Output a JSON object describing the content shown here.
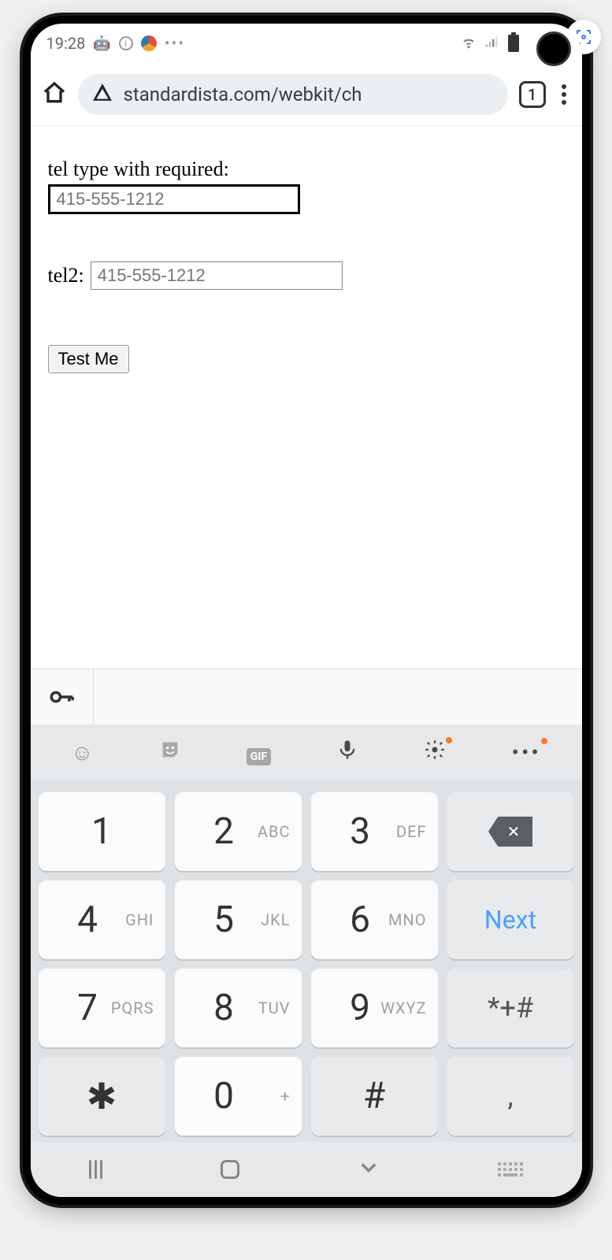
{
  "status": {
    "time": "19:28"
  },
  "browser": {
    "url": "standardista.com/webkit/ch",
    "tab_count": "1"
  },
  "page": {
    "label1": "tel type with required:",
    "input1_placeholder": "415-555-1212",
    "label2": "tel2:",
    "input2_placeholder": "415-555-1212",
    "button_label": "Test Me"
  },
  "keyboard": {
    "next_label": "Next",
    "keys": {
      "k1": {
        "d": "1",
        "l": ""
      },
      "k2": {
        "d": "2",
        "l": "ABC"
      },
      "k3": {
        "d": "3",
        "l": "DEF"
      },
      "k4": {
        "d": "4",
        "l": "GHI"
      },
      "k5": {
        "d": "5",
        "l": "JKL"
      },
      "k6": {
        "d": "6",
        "l": "MNO"
      },
      "k7": {
        "d": "7",
        "l": "PQRS"
      },
      "k8": {
        "d": "8",
        "l": "TUV"
      },
      "k9": {
        "d": "9",
        "l": "WXYZ"
      },
      "kstar": {
        "d": "✱",
        "l": ""
      },
      "k0": {
        "d": "0",
        "l": "+"
      },
      "khash": {
        "d": "#",
        "l": ""
      },
      "symkey": "*+#",
      "comma": ","
    }
  }
}
